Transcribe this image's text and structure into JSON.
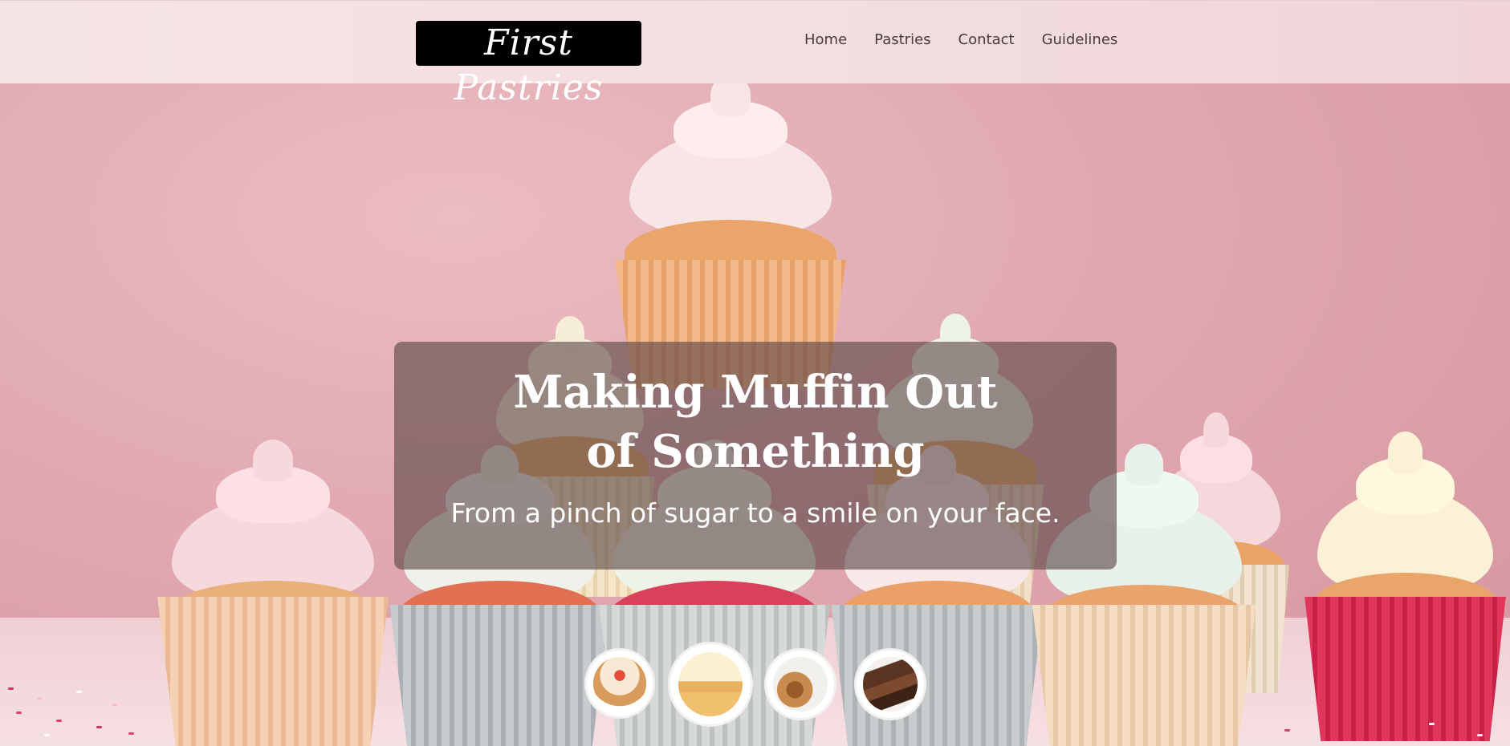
{
  "header": {
    "logo_text": "First Pastries",
    "nav": [
      {
        "label": "Home"
      },
      {
        "label": "Pastries"
      },
      {
        "label": "Contact"
      },
      {
        "label": "Guidelines"
      }
    ]
  },
  "hero": {
    "title": "Making Muffin Out of Something",
    "subtitle": "From a pinch of sugar to a smile on your face.",
    "thumbnails": [
      {
        "name": "cake-thumbnail"
      },
      {
        "name": "cupcake-thumbnail"
      },
      {
        "name": "cinnamon-rolls-thumbnail"
      },
      {
        "name": "brownies-thumbnail"
      }
    ]
  },
  "colors": {
    "header_bg": "#f4e2e4",
    "logo_bg": "#000000",
    "hero_bg": "#e3aab3",
    "overlay_bg": "rgba(90,70,70,0.62)"
  }
}
